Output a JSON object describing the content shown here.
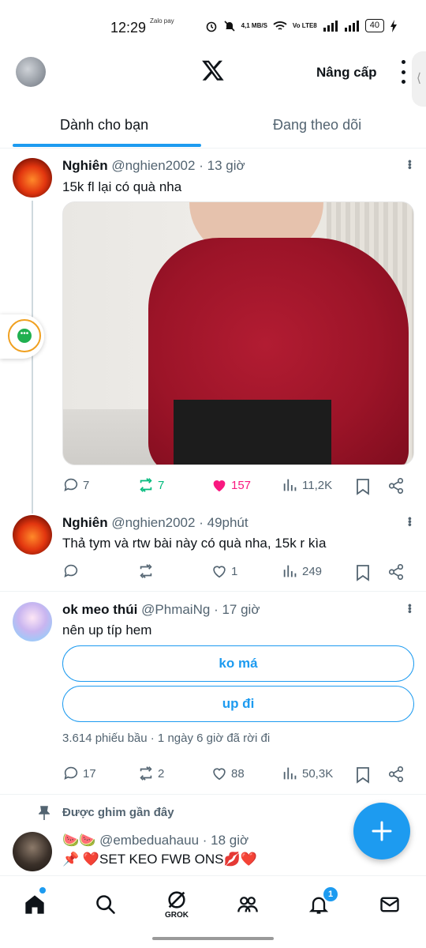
{
  "status_bar": {
    "time": "12:29",
    "zalo_pay": "Zalo pay",
    "net_speed": "4,1 MB/S",
    "net_type": "Vo LTE8",
    "battery": "40"
  },
  "header": {
    "upgrade_label": "Nâng cấp"
  },
  "tabs": [
    {
      "label": "Dành cho bạn",
      "active": true
    },
    {
      "label": "Đang theo dõi",
      "active": false
    }
  ],
  "posts": [
    {
      "name": "Nghiên",
      "handle": "@nghien2002",
      "time": "13 giờ",
      "text": "15k fl lại có quà nha",
      "replies": "7",
      "reposts": "7",
      "likes": "157",
      "views": "11,2K"
    },
    {
      "name": "Nghiên",
      "handle": "@nghien2002",
      "time": "49phút",
      "text": "Thả tym và rtw bài này có quà nha, 15k r kìa",
      "replies": "",
      "reposts": "",
      "likes": "1",
      "views": "249"
    },
    {
      "name": "ok meo thúi",
      "handle": "@PhmaiNg",
      "time": "17 giờ",
      "text": "nên up típ hem",
      "poll_options": [
        "ko má",
        "up đi"
      ],
      "poll_meta": "3.614 phiếu bầu · 1 ngày 6 giờ đã rời đi",
      "replies": "17",
      "reposts": "2",
      "likes": "88",
      "views": "50,3K"
    }
  ],
  "pinned": {
    "label": "Được ghim gần đây",
    "handle": "@embeduahauu",
    "time": "18 giờ",
    "name_emoji": "🍉🍉",
    "text": "📌 ❤️SET KEO FWB ONS💋❤️"
  },
  "bottom_nav": {
    "grok_label": "GROK",
    "notif_count": "1"
  },
  "colors": {
    "accent": "#1d9bf0",
    "like": "#f91880",
    "repost": "#00ba7c",
    "muted": "#536471"
  }
}
